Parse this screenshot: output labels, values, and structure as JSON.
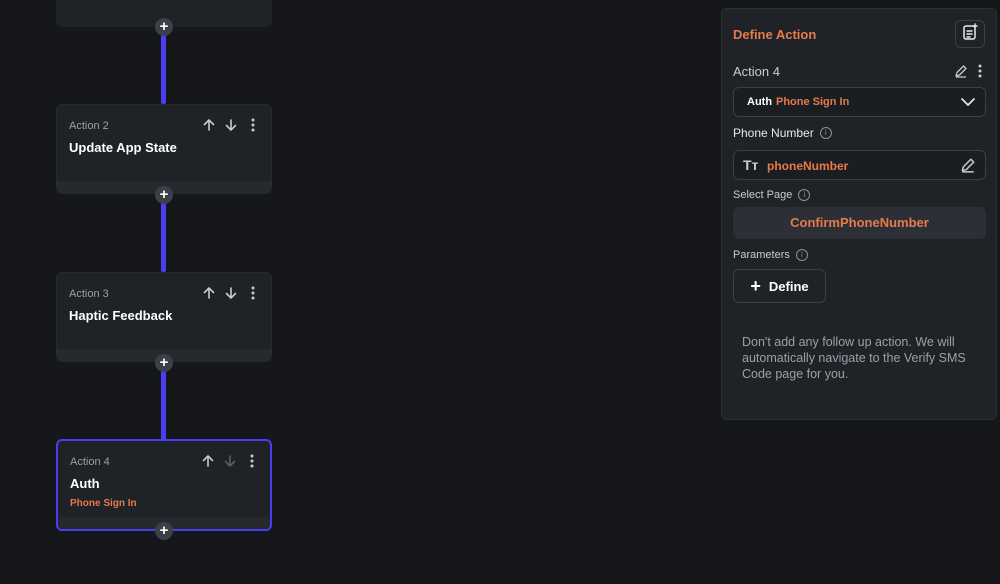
{
  "canvas": {
    "top_card": {
      "label": "",
      "title": ""
    },
    "cards": [
      {
        "label": "Action 2",
        "title": "Update App State",
        "subtitle": ""
      },
      {
        "label": "Action 3",
        "title": "Haptic Feedback",
        "subtitle": ""
      },
      {
        "label": "Action 4",
        "title": "Auth",
        "subtitle": "Phone Sign In"
      }
    ],
    "add_symbol": "+"
  },
  "panel": {
    "title": "Define Action",
    "action_label": "Action 4",
    "action_type": {
      "main": "Auth",
      "sub": "Phone Sign In"
    },
    "phone_number": {
      "label": "Phone Number",
      "value": "phoneNumber",
      "type_icon": "Tт"
    },
    "select_page": {
      "label": "Select Page",
      "value": "ConfirmPhoneNumber"
    },
    "parameters": {
      "label": "Parameters",
      "define_label": "Define",
      "define_symbol": "+"
    },
    "note": "Don't add any follow up action. We will automatically navigate to the Verify SMS Code page for you.",
    "info_symbol": "i"
  },
  "colors": {
    "accent": "#4a3ff0",
    "highlight": "#e57b4a",
    "background": "#15171a"
  }
}
